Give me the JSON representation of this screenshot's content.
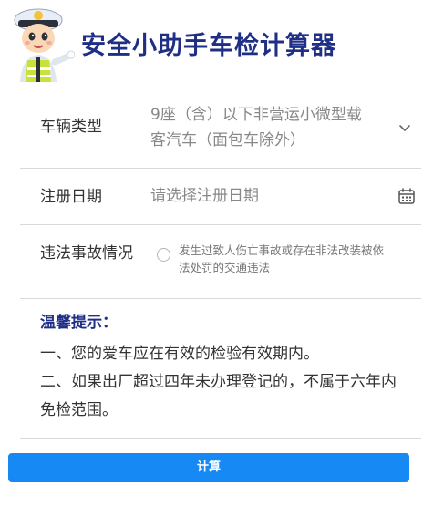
{
  "header": {
    "title": "安全小助手车检计算器",
    "mascot_icon": "traffic-police-mascot-icon"
  },
  "form": {
    "vehicle_type": {
      "label": "车辆类型",
      "value": "9座（含）以下非营运小微型载客汽车（面包车除外）",
      "icon": "chevron-down-icon"
    },
    "registration_date": {
      "label": "注册日期",
      "placeholder": "请选择注册日期",
      "icon": "calendar-icon"
    },
    "violation": {
      "label": "违法事故情况",
      "option_text": "发生过致人伤亡事故或存在非法改装被依法处罚的交通违法",
      "checked": false
    }
  },
  "tips": {
    "title": "温馨提示：",
    "lines": [
      "一、您的爱车应在有效的检验有效期内。",
      "二、如果出厂超过四年未办理登记的，不属于六年内免检范围。"
    ]
  },
  "actions": {
    "calculate_label": "计算"
  },
  "colors": {
    "title": "#1f2f86",
    "button": "#1689f5",
    "divider": "#d9d9d9"
  }
}
